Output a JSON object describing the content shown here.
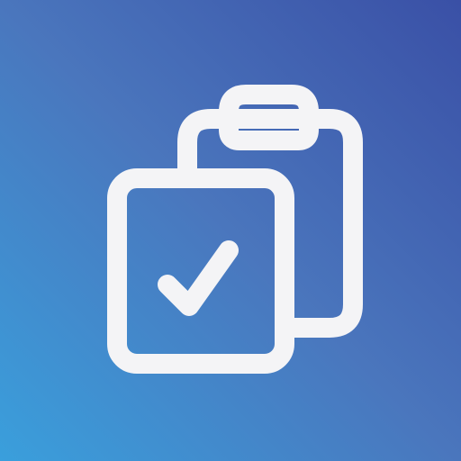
{
  "icon": {
    "name": "clipboard-check-icon",
    "colors": {
      "gradient_start": "#3a9fdc",
      "gradient_mid": "#4a76bd",
      "gradient_end": "#3a50a6",
      "stroke": "#f4f4f6"
    }
  }
}
